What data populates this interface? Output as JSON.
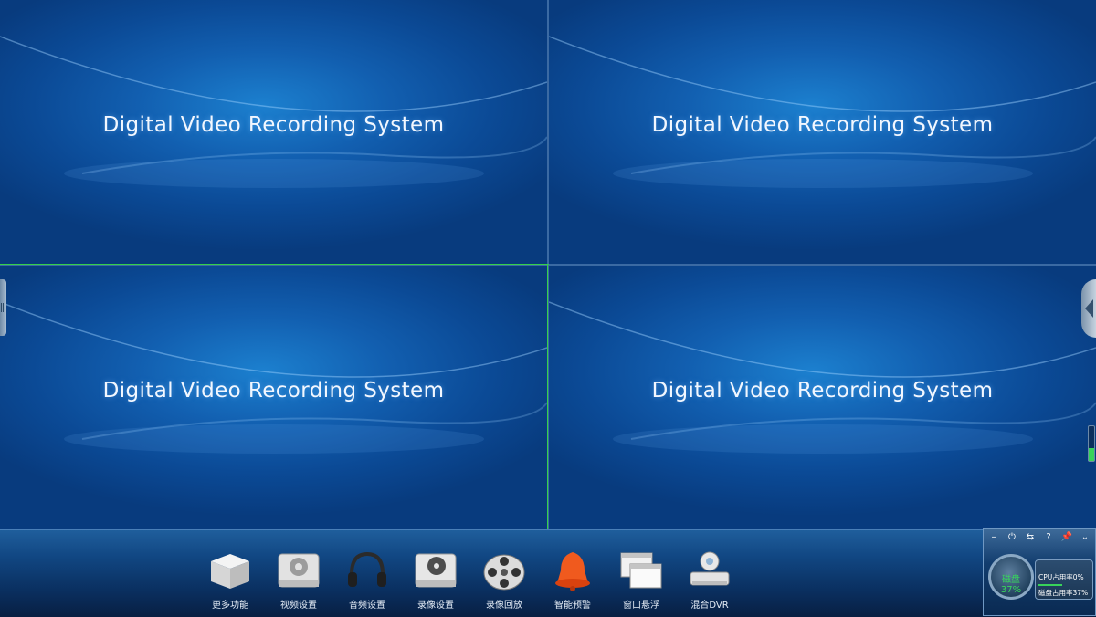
{
  "panes": [
    {
      "title": "Digital Video Recording System"
    },
    {
      "title": "Digital Video Recording System"
    },
    {
      "title": "Digital Video Recording System"
    },
    {
      "title": "Digital Video Recording System"
    }
  ],
  "toolbar": {
    "items": [
      {
        "label": "更多功能",
        "icon": "more-functions-box-icon"
      },
      {
        "label": "视频设置",
        "icon": "video-settings-gear-icon"
      },
      {
        "label": "音频设置",
        "icon": "headphones-icon"
      },
      {
        "label": "录像设置",
        "icon": "record-settings-film-icon"
      },
      {
        "label": "录像回放",
        "icon": "film-reel-icon"
      },
      {
        "label": "智能预警",
        "icon": "alarm-bell-icon"
      },
      {
        "label": "窗口悬浮",
        "icon": "floating-windows-icon"
      },
      {
        "label": "混合DVR",
        "icon": "camera-dvr-icon"
      }
    ]
  },
  "status_panel": {
    "buttons": [
      "–",
      "⏻",
      "⇆",
      "?",
      "📌",
      "⌄"
    ],
    "gauge_text": "磁盘 37%",
    "cpu_text": "CPU占用率0%",
    "disk_text": "磁盘占用率37%"
  },
  "colors": {
    "selection": "#35d04a",
    "pane_bg": "#125fb0",
    "toolbar_bg": "#114783"
  }
}
